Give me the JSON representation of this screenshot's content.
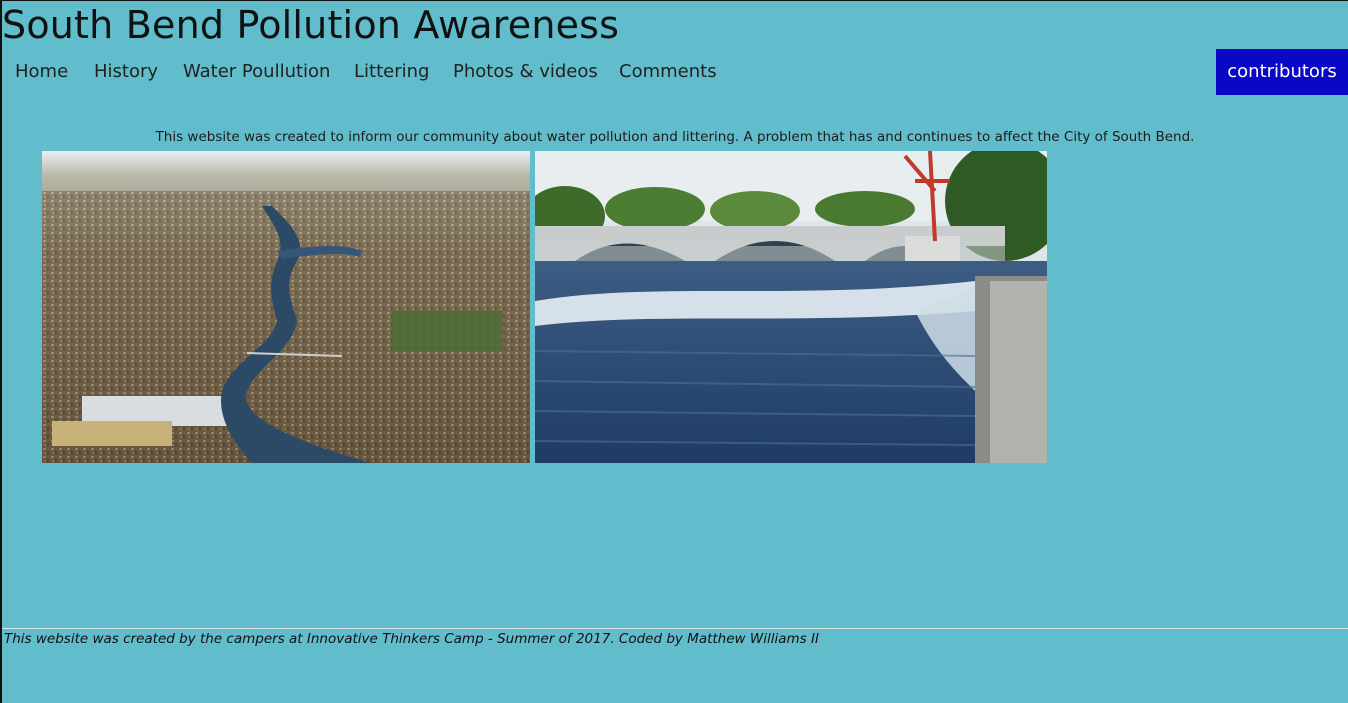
{
  "site": {
    "title": "South Bend Pollution Awareness"
  },
  "nav": {
    "items": [
      {
        "label": "Home"
      },
      {
        "label": "History"
      },
      {
        "label": "Water Poullution"
      },
      {
        "label": "Littering"
      },
      {
        "label": "Photos & videos"
      },
      {
        "label": "Comments"
      }
    ],
    "contributors_label": "contributors"
  },
  "main": {
    "intro": "This website was created to inform our community about water pollution and littering. A problem that has and continues to affect the City of South Bend."
  },
  "footer": {
    "text": "This website was created by the campers at Innovative Thinkers Camp - Summer of 2017. Coded by Matthew Williams II"
  },
  "colors": {
    "background": "#61bccc",
    "contributors_button": "#0a08c4",
    "contributors_text": "#ffffff"
  }
}
